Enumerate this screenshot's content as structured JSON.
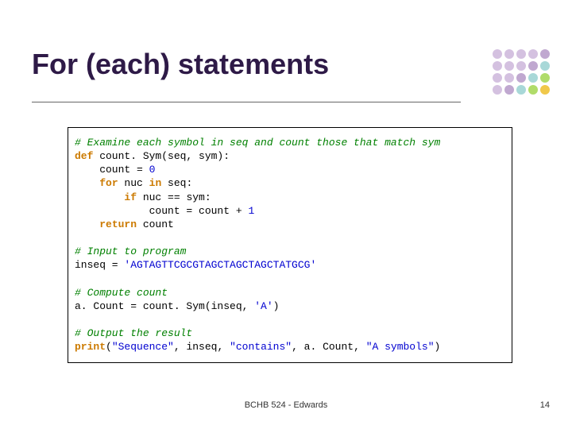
{
  "title": "For (each) statements",
  "dots": [
    "#d4c1e0",
    "#d4c1e0",
    "#d4c1e0",
    "#d4c1e0",
    "#c0a8d0",
    "#d4c1e0",
    "#d4c1e0",
    "#d4c1e0",
    "#c0a8d0",
    "#a8d8d8",
    "#d4c1e0",
    "#d4c1e0",
    "#c0a8d0",
    "#a8d8d8",
    "#b0dc6a",
    "#d4c1e0",
    "#c0a8d0",
    "#a8d8d8",
    "#b0dc6a",
    "#f0c84a"
  ],
  "code": {
    "c1": "# Examine each symbol in seq and count those that match sym",
    "def": "def",
    "fn": " count. Sym(seq, sym):",
    "assign1a": "    count = ",
    "zero": "0",
    "for": "for",
    "forrest": " nuc ",
    "in": "in",
    "forrest2": " seq:",
    "if": "if",
    "ifrest": " nuc == sym:",
    "assign2a": "            count = count + ",
    "one": "1",
    "return": "return",
    "retrest": " count",
    "c2": "# Input to program",
    "inseq": "inseq = ",
    "str1": "'AGTAGTTCGCGTAGCTAGCTAGCTATGCG'",
    "c3": "# Compute count",
    "acount": "a. Count = count. Sym(inseq, ",
    "strA": "'A'",
    "acount2": ")",
    "c4": "# Output the result",
    "print": "print",
    "p_open": "(",
    "s_seq": "\"Sequence\"",
    "comma1": ", inseq, ",
    "s_contains": "\"contains\"",
    "comma2": ", a. Count, ",
    "s_asym": "\"A symbols\"",
    "p_close": ")"
  },
  "footer": "BCHB 524 - Edwards",
  "page": "14"
}
